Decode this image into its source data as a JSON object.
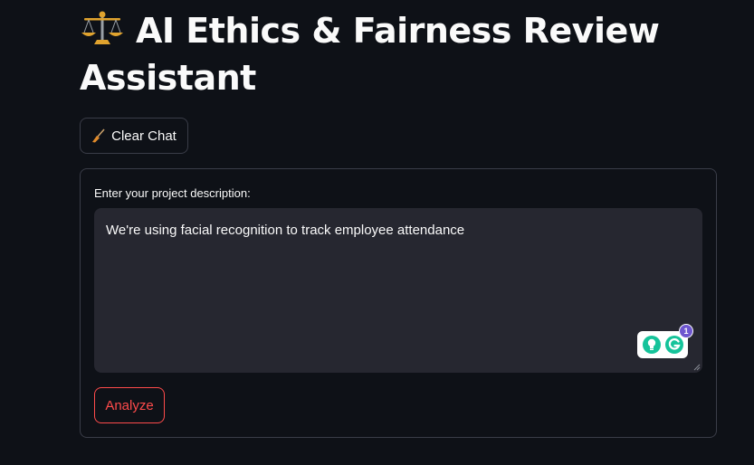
{
  "header": {
    "title": "AI Ethics & Fairness Review Assistant",
    "title_icon": "balance-scale-icon"
  },
  "toolbar": {
    "clear_label": "Clear Chat",
    "clear_icon": "broom-icon"
  },
  "form": {
    "label": "Enter your project description:",
    "value": "We're using facial recognition to track employee attendance",
    "submit_label": "Analyze"
  },
  "grammarly": {
    "badge_count": "1"
  },
  "colors": {
    "background": "#0e1117",
    "input_background": "#262730",
    "border": "#3a3d48",
    "accent": "#ff4b4b",
    "text": "#fafafa"
  }
}
